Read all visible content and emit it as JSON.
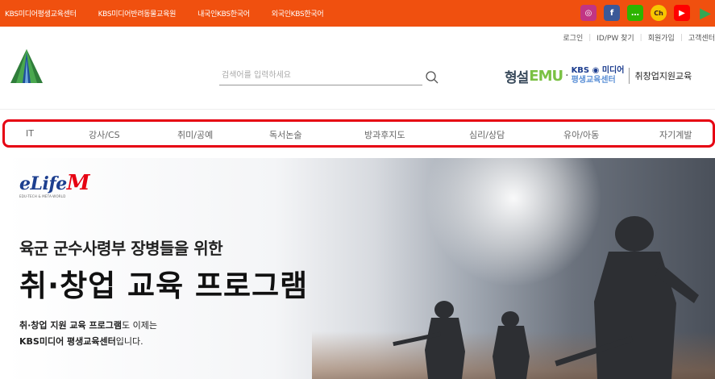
{
  "topbar": {
    "links": [
      "KBS미디어평생교육센터",
      "KBS미디어반려동물교육원",
      "내국인KBS한국어",
      "외국인KBS한국어"
    ],
    "socials": [
      {
        "name": "instagram-icon",
        "color": "#c13584",
        "glyph": "◎"
      },
      {
        "name": "facebook-icon",
        "color": "#3b5998",
        "glyph": "f"
      },
      {
        "name": "chat-icon",
        "color": "#2db400",
        "glyph": "…"
      },
      {
        "name": "kakao-channel-icon",
        "color": "#f7c600",
        "glyph": "Ch"
      },
      {
        "name": "youtube-icon",
        "color": "#ff0000",
        "glyph": "▶"
      },
      {
        "name": "play-icon",
        "color": "#34a853",
        "glyph": "▶"
      }
    ]
  },
  "util": {
    "login": "로그인",
    "find": "ID/PW 찾기",
    "join": "회원가입",
    "support": "고객센터"
  },
  "search": {
    "placeholder": "검색어를 입력하세요"
  },
  "brand": {
    "hyeongseol": "형설",
    "emu": "EMU",
    "kbs_line1": "KBS",
    "kbs_media": "미디어",
    "kbs_line2": "평생교육센터",
    "job": "취창업지원교육"
  },
  "categories": [
    "IT",
    "강사/CS",
    "취미/공예",
    "독서논술",
    "방과후지도",
    "심리/상담",
    "유아/아동",
    "자기계발"
  ],
  "banner": {
    "logo_e": "e",
    "logo_life": "Life",
    "logo_m": "M",
    "logo_tag": "EDU-TECH & META-WORLD",
    "subtitle": "육군 군수사령부 장병들을 위한",
    "title": "취·창업 교육 프로그램",
    "desc1_bold": "취·창업 지원 교육 프로그램",
    "desc1_rest": "도 이제는",
    "desc2_bold": "KBS미디어 평생교육센터",
    "desc2_rest": "입니다."
  },
  "colors": {
    "topbar": "#f0500f",
    "nav_border": "#e60012",
    "brand_navy": "#1b3c8e",
    "emu_green": "#7ac143"
  }
}
